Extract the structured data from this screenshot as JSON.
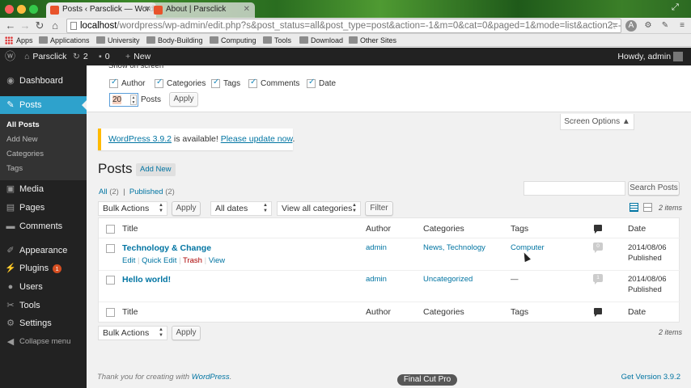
{
  "browser": {
    "tabs": [
      {
        "label": "Posts ‹ Parsclick — WordPr…",
        "active": true
      },
      {
        "label": "About | Parsclick",
        "active": false
      }
    ],
    "url_host": "localhost",
    "url_path": "/wordpress/wp-admin/edit.php?s&post_status=all&post_type=post&action=-1&m=0&cat=0&paged=1&mode=list&action2=-1",
    "bookmarks": [
      "Apps",
      "Applications",
      "University",
      "Body-Building",
      "Computing",
      "Tools",
      "Download",
      "Other Sites"
    ]
  },
  "adminbar": {
    "site_name": "Parsclick",
    "updates_count": "2",
    "comments_count": "0",
    "new_label": "New",
    "howdy": "Howdy, admin"
  },
  "sidebar": {
    "items": [
      {
        "label": "Dashboard",
        "icon": "dashboard-icon"
      },
      {
        "label": "Posts",
        "icon": "pin-icon"
      },
      {
        "label": "Media",
        "icon": "media-icon"
      },
      {
        "label": "Pages",
        "icon": "page-icon"
      },
      {
        "label": "Comments",
        "icon": "comment-icon"
      },
      {
        "label": "Appearance",
        "icon": "brush-icon"
      },
      {
        "label": "Plugins",
        "icon": "plug-icon",
        "badge": "1"
      },
      {
        "label": "Users",
        "icon": "user-icon"
      },
      {
        "label": "Tools",
        "icon": "wrench-icon"
      },
      {
        "label": "Settings",
        "icon": "settings-icon"
      },
      {
        "label": "Collapse menu",
        "icon": "collapse-icon"
      }
    ],
    "submenu": [
      "All Posts",
      "Add New",
      "Categories",
      "Tags"
    ]
  },
  "screen_options": {
    "heading": "Show on screen",
    "columns": [
      "Author",
      "Categories",
      "Tags",
      "Comments",
      "Date"
    ],
    "per_page_value": "20",
    "per_page_label": "Posts",
    "apply_label": "Apply",
    "tab_label": "Screen Options ▲"
  },
  "notice": {
    "link_version": "WordPress 3.9.2",
    "middle": " is available! ",
    "link_update": "Please update now",
    "end": "."
  },
  "page": {
    "title": "Posts",
    "add_new": "Add New",
    "filter_all": "All",
    "filter_all_count": "(2)",
    "filter_published": "Published",
    "filter_published_count": "(2)",
    "search_button": "Search Posts",
    "bulk_actions": "Bulk Actions",
    "apply": "Apply",
    "all_dates": "All dates",
    "all_categories": "View all categories",
    "filter": "Filter",
    "items_count": "2 items"
  },
  "table": {
    "headers": [
      "Title",
      "Author",
      "Categories",
      "Tags",
      "Date"
    ],
    "rows": [
      {
        "title": "Technology & Change",
        "author": "admin",
        "categories": "News, Technology",
        "tags": "Computer",
        "comments": "0",
        "date": "2014/08/06",
        "status": "Published",
        "actions": [
          "Edit",
          "Quick Edit",
          "Trash",
          "View"
        ]
      },
      {
        "title": "Hello world!",
        "author": "admin",
        "categories": "Uncategorized",
        "tags": "—",
        "comments": "1",
        "date": "2014/08/06",
        "status": "Published"
      }
    ]
  },
  "footer": {
    "thanks_prefix": "Thank you for creating with ",
    "thanks_link": "WordPress",
    "thanks_suffix": ".",
    "version": "Get Version 3.9.2"
  },
  "overlay": {
    "label": "Final Cut Pro"
  },
  "colors": {
    "accent": "#2ea2cc",
    "link": "#0074a2",
    "adminbar": "#222222",
    "notice": "#ffba00",
    "badge": "#d54e21"
  }
}
